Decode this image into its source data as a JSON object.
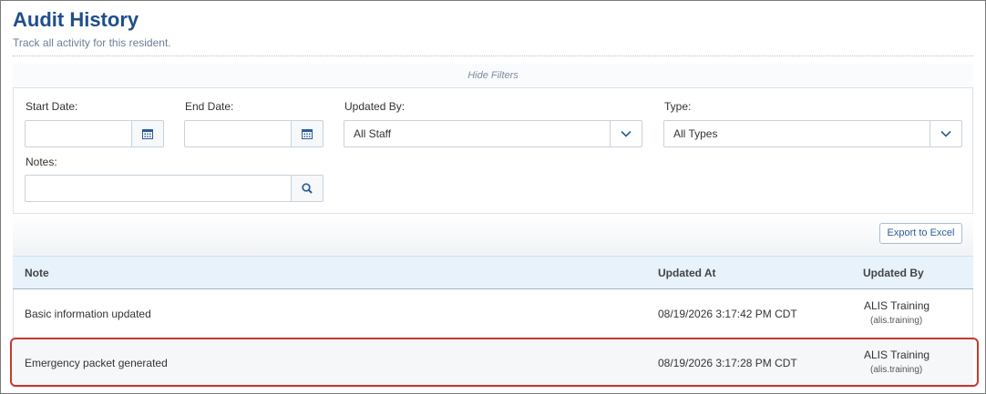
{
  "header": {
    "title": "Audit History",
    "subtitle": "Track all activity for this resident."
  },
  "filters": {
    "toggle_label": "Hide Filters",
    "start_date": {
      "label": "Start Date:",
      "value": ""
    },
    "end_date": {
      "label": "End Date:",
      "value": ""
    },
    "updated_by": {
      "label": "Updated By:",
      "selected": "All Staff"
    },
    "type": {
      "label": "Type:",
      "selected": "All Types"
    },
    "notes": {
      "label": "Notes:",
      "value": ""
    }
  },
  "toolbar": {
    "export_label": "Export to Excel"
  },
  "table": {
    "columns": [
      "Note",
      "Updated At",
      "Updated By"
    ],
    "rows": [
      {
        "note": "Basic information updated",
        "updated_at": "08/19/2026 3:17:42 PM CDT",
        "updated_by_name": "ALIS Training",
        "updated_by_user": "(alis.training)"
      },
      {
        "note": "Emergency packet generated",
        "updated_at": "08/19/2026 3:17:28 PM CDT",
        "updated_by_name": "ALIS Training",
        "updated_by_user": "(alis.training)"
      }
    ]
  },
  "colors": {
    "title": "#1f4e8c",
    "highlight_border": "#c8372d",
    "header_bg": "#e8f2fb",
    "icon": "#2a5d98"
  },
  "icons": {
    "date_picker": "calendar-icon",
    "dropdown": "chevron-down-icon",
    "search": "search-icon"
  }
}
